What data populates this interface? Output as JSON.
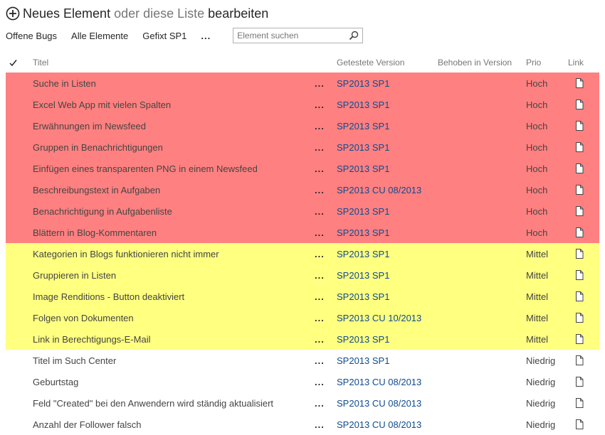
{
  "header": {
    "new_item": "Neues Element",
    "or": "oder",
    "this_list": "diese Liste",
    "edit": "bearbeiten"
  },
  "views": {
    "items": [
      "Offene Bugs",
      "Alle Elemente",
      "Gefixt SP1"
    ],
    "more": "..."
  },
  "search": {
    "placeholder": "Element suchen"
  },
  "columns": {
    "title": "Titel",
    "tested_version": "Getestete Version",
    "fixed_version": "Behoben in Version",
    "priority": "Prio",
    "link": "Link"
  },
  "icons": {
    "new": "plus-circle-icon",
    "search": "magnifier-icon",
    "check": "checkmark-icon",
    "link": "document-icon"
  },
  "colors": {
    "high": "#ff8080",
    "medium": "#ffff80",
    "low": "#ffffff",
    "version_link": "#0f4b8f"
  },
  "rows": [
    {
      "title": "Suche in Listen",
      "version": "SP2013 SP1",
      "fixed": "",
      "prio": "Hoch"
    },
    {
      "title": "Excel Web App mit vielen Spalten",
      "version": "SP2013 SP1",
      "fixed": "",
      "prio": "Hoch"
    },
    {
      "title": "Erwähnungen im Newsfeed",
      "version": "SP2013 SP1",
      "fixed": "",
      "prio": "Hoch"
    },
    {
      "title": "Gruppen in Benachrichtigungen",
      "version": "SP2013 SP1",
      "fixed": "",
      "prio": "Hoch"
    },
    {
      "title": "Einfügen eines transparenten PNG in einem Newsfeed",
      "version": "SP2013 SP1",
      "fixed": "",
      "prio": "Hoch"
    },
    {
      "title": "Beschreibungstext in Aufgaben",
      "version": "SP2013 CU 08/2013",
      "fixed": "",
      "prio": "Hoch"
    },
    {
      "title": "Benachrichtigung in Aufgabenliste",
      "version": "SP2013 SP1",
      "fixed": "",
      "prio": "Hoch"
    },
    {
      "title": "Blättern in Blog-Kommentaren",
      "version": "SP2013 SP1",
      "fixed": "",
      "prio": "Hoch"
    },
    {
      "title": "Kategorien in Blogs funktionieren nicht immer",
      "version": "SP2013 SP1",
      "fixed": "",
      "prio": "Mittel"
    },
    {
      "title": "Gruppieren in Listen",
      "version": "SP2013 SP1",
      "fixed": "",
      "prio": "Mittel"
    },
    {
      "title": "Image Renditions - Button deaktiviert",
      "version": "SP2013 SP1",
      "fixed": "",
      "prio": "Mittel"
    },
    {
      "title": "Folgen von Dokumenten",
      "version": "SP2013 CU 10/2013",
      "fixed": "",
      "prio": "Mittel"
    },
    {
      "title": "Link in Berechtigungs-E-Mail",
      "version": "SP2013 SP1",
      "fixed": "",
      "prio": "Mittel"
    },
    {
      "title": "Titel im Such Center",
      "version": "SP2013 SP1",
      "fixed": "",
      "prio": "Niedrig"
    },
    {
      "title": "Geburtstag",
      "version": "SP2013 CU 08/2013",
      "fixed": "",
      "prio": "Niedrig"
    },
    {
      "title": "Feld \"Created\" bei den Anwendern wird ständig aktualisiert",
      "version": "SP2013 CU 08/2013",
      "fixed": "",
      "prio": "Niedrig"
    },
    {
      "title": "Anzahl der Follower falsch",
      "version": "SP2013 CU 08/2013",
      "fixed": "",
      "prio": "Niedrig"
    }
  ]
}
